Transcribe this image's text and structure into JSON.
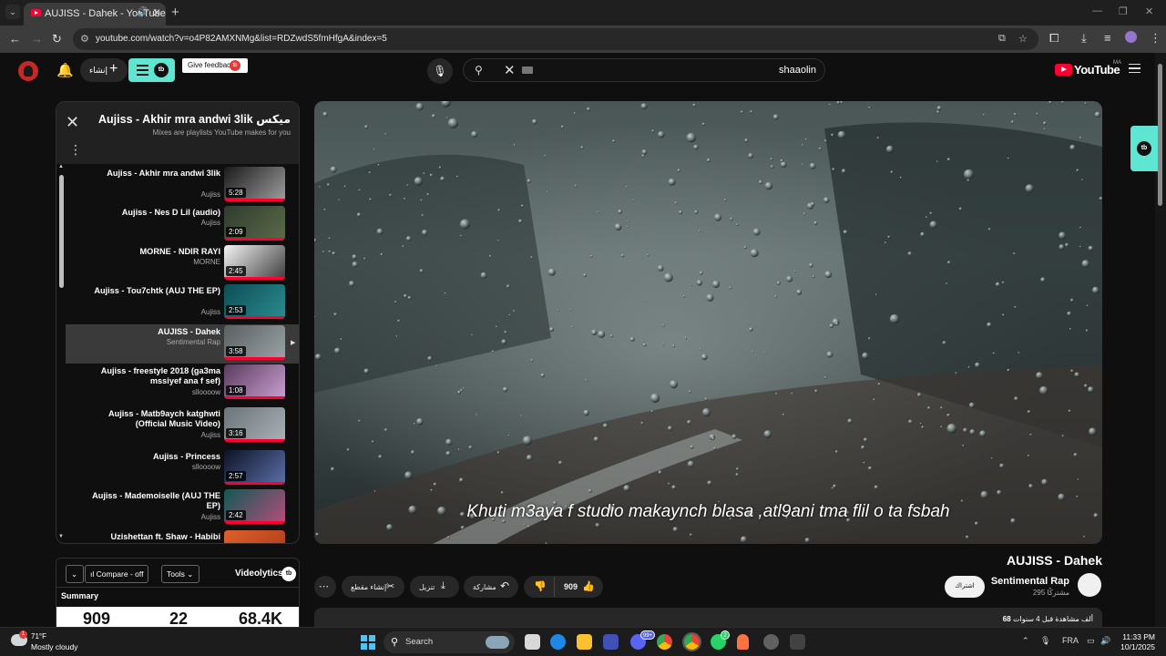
{
  "browser": {
    "tab_title": "AUJISS - Dahek - YouTube",
    "url": "youtube.com/watch?v=o4P82AMXNMg&list=RDZwdS5fmHfgA&index=5"
  },
  "header": {
    "create_label": "إنشاء",
    "extension_logo": "tb",
    "feedback_label": "Give feedback",
    "search_query": "shaaolin",
    "logo_text": "YouTube",
    "country_code": "MA"
  },
  "playlist": {
    "title": "Aujiss - Akhir mra andwi 3lik ميكس",
    "subtitle": "Mixes are playlists YouTube makes for you",
    "items": [
      {
        "title": "Aujiss - Akhir mra andwi 3lik",
        "author": "Aujiss",
        "duration": "5:28"
      },
      {
        "title": "Aujiss - Nes D Lil (audio)",
        "author": "Aujiss",
        "duration": "2:09"
      },
      {
        "title": "MORNE - NDIR RAYI",
        "author": "MORNE",
        "duration": "2:45"
      },
      {
        "title": "Aujiss - Tou7chtk (AUJ THE EP)",
        "author": "Aujiss",
        "duration": "2:53"
      },
      {
        "title": "AUJISS - Dahek",
        "author": "Sentimental Rap",
        "duration": "3:58"
      },
      {
        "title": "Aujiss - freestyle 2018 (ga3ma mssiyef ana f sef)",
        "author": "slloooow",
        "duration": "1:08"
      },
      {
        "title": "Aujiss - Matb9aych katghwti (Official Music Video)",
        "author": "Aujiss",
        "duration": "3:16"
      },
      {
        "title": "Aujiss - Princess",
        "author": "slloooow",
        "duration": "2:57"
      },
      {
        "title": "Aujiss - Mademoiselle (AUJ THE EP)",
        "author": "Aujiss",
        "duration": "2:42"
      },
      {
        "title": "Uzishettan ft. Shaw - Habibi",
        "author": "",
        "duration": ""
      }
    ]
  },
  "video": {
    "caption": "Khuti m3aya f studio makaynch blasa ,atl9ani tma flil o ta fsbah",
    "title": "AUJISS - Dahek",
    "channel": "Sentimental Rap",
    "subscribers": "295 مشتركًا",
    "subscribe_label": "اشتراك",
    "likes": "909",
    "share_label": "مشاركة",
    "download_label": "تنزيل",
    "clip_label": "إنشاء مقطع",
    "description_prefix": "68",
    "description_text": "ألف مشاهدة قبل 4 سنوات"
  },
  "videolytics": {
    "compare_label": "Compare - off",
    "tools_label": "Tools",
    "brand": "Videolytics",
    "summary_label": "Summary",
    "stats": [
      "909",
      "22",
      "68.4K"
    ]
  },
  "taskbar": {
    "temperature": "71°F",
    "condition": "Mostly cloudy",
    "weather_badge": "1",
    "search_label": "Search",
    "discord_badge": "99+",
    "whatsapp_badge": "2",
    "language": "FRA",
    "time": "11:33 PM",
    "date": "10/1/2025"
  },
  "colors": {
    "accent_teal": "#5ee6d2",
    "youtube_red": "#ff0033",
    "background": "#0f0f0f"
  }
}
